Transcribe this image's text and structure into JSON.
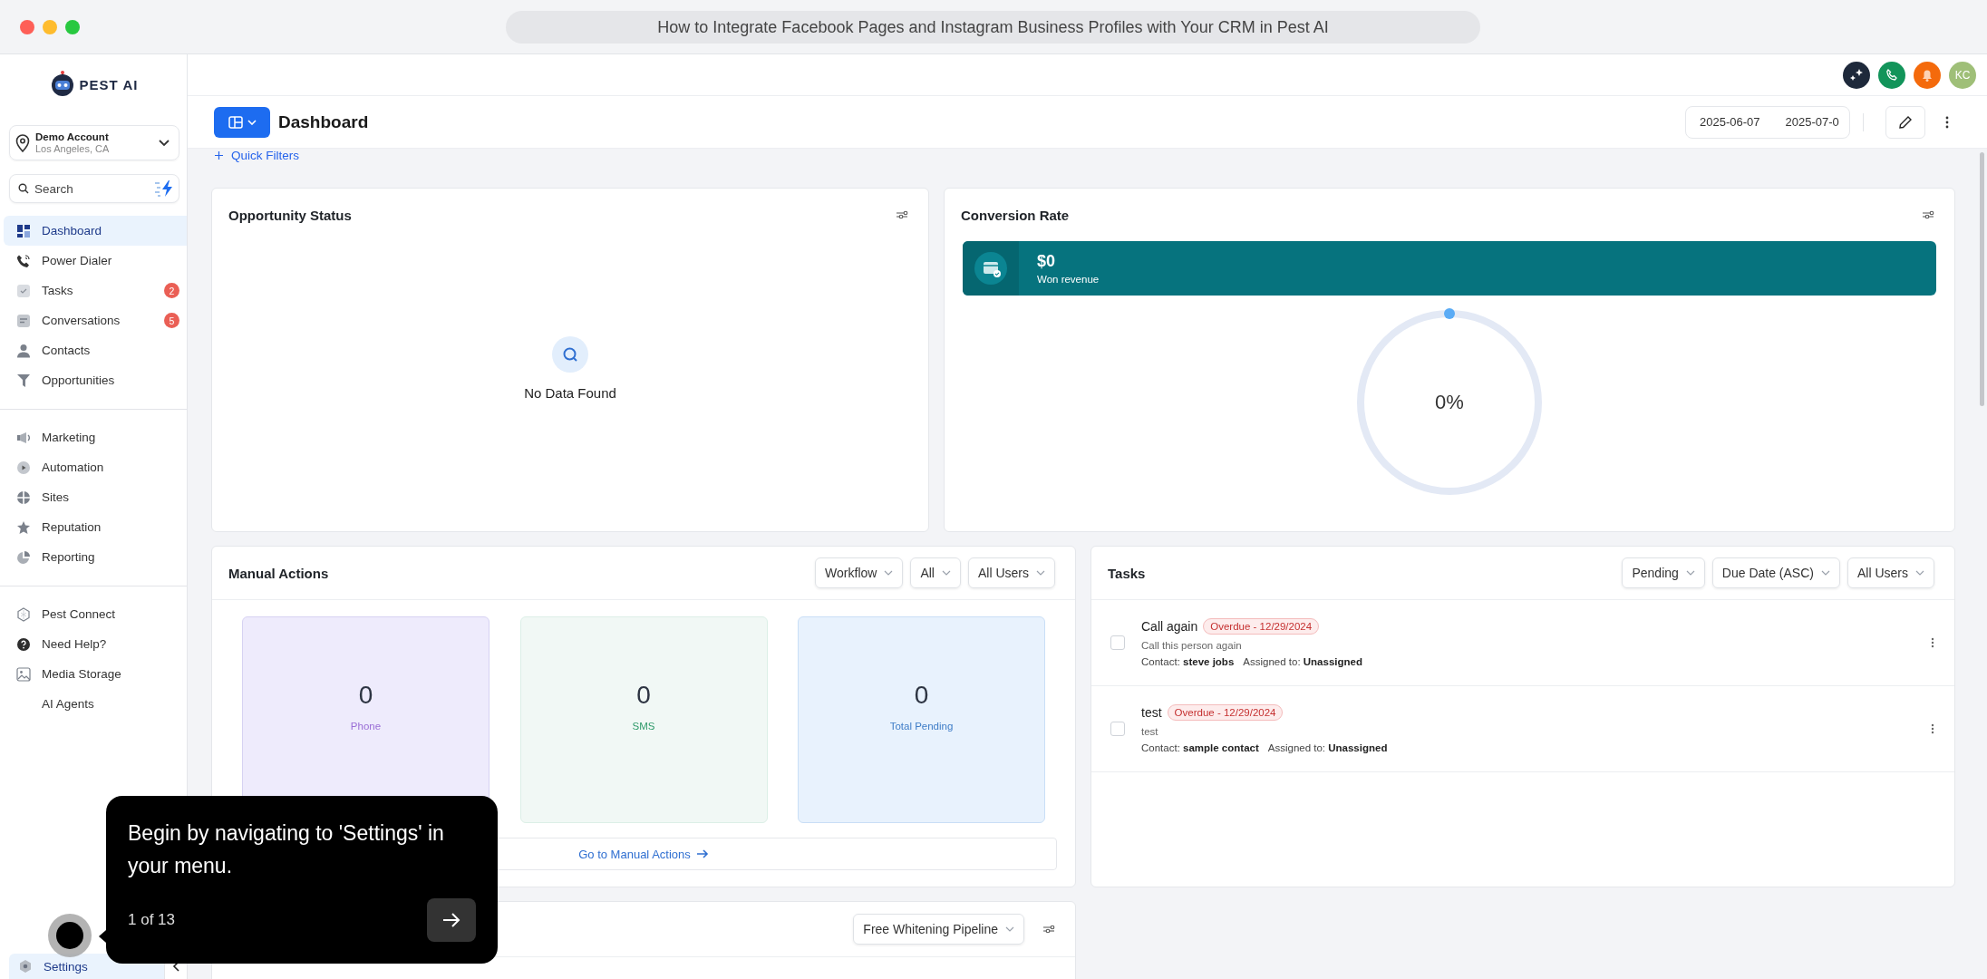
{
  "browser": {
    "title": "How to Integrate Facebook Pages and Instagram Business Profiles with Your CRM in Pest AI"
  },
  "sidebar": {
    "logo": "PEST AI",
    "account": {
      "name": "Demo Account",
      "location": "Los Angeles, CA"
    },
    "search": {
      "placeholder": "Search"
    },
    "groups": [
      [
        {
          "label": "Dashboard",
          "selected": true
        },
        {
          "label": "Power Dialer",
          "selected": false
        },
        {
          "label": "Tasks",
          "badge": "2",
          "selected": false
        },
        {
          "label": "Conversations",
          "badge": "5",
          "selected": false
        },
        {
          "label": "Contacts",
          "selected": false
        },
        {
          "label": "Opportunities",
          "selected": false
        }
      ],
      [
        {
          "label": "Marketing",
          "selected": false
        },
        {
          "label": "Automation",
          "selected": false
        },
        {
          "label": "Sites",
          "selected": false
        },
        {
          "label": "Reputation",
          "selected": false
        },
        {
          "label": "Reporting",
          "selected": false
        }
      ],
      [
        {
          "label": "Pest Connect",
          "selected": false
        },
        {
          "label": "Need Help?",
          "selected": false
        },
        {
          "label": "Media Storage",
          "selected": false
        },
        {
          "label": "AI Agents",
          "selected": false
        }
      ]
    ],
    "footer": {
      "label": "Settings",
      "selected": true
    }
  },
  "header": {
    "user_initials": "KC"
  },
  "dashboard": {
    "title": "Dashboard",
    "date_from": "2025-06-07",
    "date_to": "2025-07-0",
    "quick_filters": "Quick Filters"
  },
  "opportunity_status": {
    "title": "Opportunity Status",
    "empty": "No Data Found"
  },
  "conversion_rate": {
    "title": "Conversion Rate",
    "revenue": "$0",
    "revenue_label": "Won revenue",
    "reading": "0%"
  },
  "manual_actions": {
    "title": "Manual Actions",
    "filters": [
      "Workflow",
      "All",
      "All Users"
    ],
    "stats": [
      {
        "value": "0",
        "label": "Phone",
        "color": "#eeebfc"
      },
      {
        "value": "0",
        "label": "SMS",
        "color": "#f1f8f5"
      },
      {
        "value": "0",
        "label": "Total Pending",
        "color": "#e8f2fd"
      }
    ],
    "link": "Go to Manual Actions"
  },
  "tasks": {
    "title": "Tasks",
    "filters": [
      "Pending",
      "Due Date (ASC)",
      "All Users"
    ],
    "items": [
      {
        "title": "Call again",
        "badge": "Overdue - 12/29/2024",
        "description": "Call this person again",
        "contact_label": "Contact:",
        "contact": "steve jobs",
        "assigned_label": "Assigned to:",
        "assignee": "Unassigned",
        "checked": false
      },
      {
        "title": "test",
        "badge": "Overdue - 12/29/2024",
        "description": "test",
        "contact_label": "Contact:",
        "contact": "sample contact",
        "assigned_label": "Assigned to:",
        "assignee": "Unassigned",
        "checked": false
      }
    ]
  },
  "pipeline": {
    "filter": "Free Whitening Pipeline"
  },
  "tour": {
    "text": "Begin by navigating to 'Settings' in your menu.",
    "progress": "1 of 13"
  }
}
